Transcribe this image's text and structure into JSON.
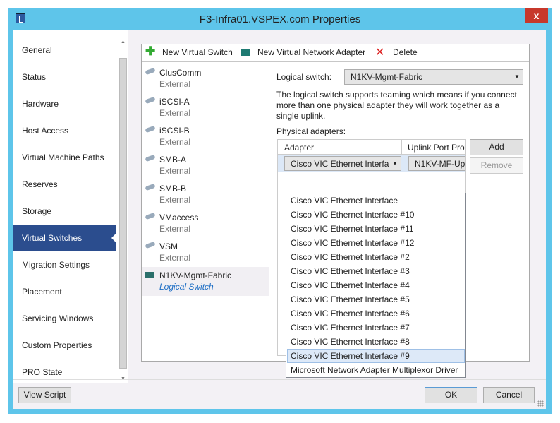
{
  "window": {
    "title": "F3-Infra01.VSPEX.com Properties",
    "close": "x"
  },
  "nav": {
    "items": [
      "General",
      "Status",
      "Hardware",
      "Host Access",
      "Virtual Machine Paths",
      "Reserves",
      "Storage",
      "Virtual Switches",
      "Migration Settings",
      "Placement",
      "Servicing Windows",
      "Custom Properties",
      "PRO State"
    ],
    "selected": "Virtual Switches"
  },
  "toolbar": {
    "new_switch": "New Virtual Switch",
    "new_adapter": "New Virtual Network Adapter",
    "delete": "Delete"
  },
  "switches": [
    {
      "name": "ClusComm",
      "type": "External"
    },
    {
      "name": "iSCSI-A",
      "type": "External"
    },
    {
      "name": "iSCSI-B",
      "type": "External"
    },
    {
      "name": "SMB-A",
      "type": "External"
    },
    {
      "name": "SMB-B",
      "type": "External"
    },
    {
      "name": "VMaccess",
      "type": "External"
    },
    {
      "name": "VSM",
      "type": "External"
    },
    {
      "name": "N1KV-Mgmt-Fabric",
      "type": "Logical Switch"
    }
  ],
  "detail": {
    "logical_switch_label": "Logical switch:",
    "logical_switch_value": "N1KV-Mgmt-Fabric",
    "description": "The logical switch supports teaming which means if you connect more than one physical adapter they will work together as a single uplink.",
    "physical_adapters_label": "Physical adapters:",
    "col_adapter": "Adapter",
    "col_uplink": "Uplink Port Prof",
    "row_adapter": "Cisco VIC Ethernet Interfa",
    "row_uplink": "N1KV-MF-Upl",
    "add": "Add",
    "remove": "Remove"
  },
  "dropdown": {
    "options": [
      "Cisco VIC Ethernet Interface",
      "Cisco VIC Ethernet Interface #10",
      "Cisco VIC Ethernet Interface #11",
      "Cisco VIC Ethernet Interface #12",
      "Cisco VIC Ethernet Interface #2",
      "Cisco VIC Ethernet Interface #3",
      "Cisco VIC Ethernet Interface #4",
      "Cisco VIC Ethernet Interface #5",
      "Cisco VIC Ethernet Interface #6",
      "Cisco VIC Ethernet Interface #7",
      "Cisco VIC Ethernet Interface #8",
      "Cisco VIC Ethernet Interface #9",
      "Microsoft Network Adapter Multiplexor Driver"
    ],
    "highlighted": "Cisco VIC Ethernet Interface #9"
  },
  "footer": {
    "view_script": "View Script",
    "ok": "OK",
    "cancel": "Cancel"
  }
}
